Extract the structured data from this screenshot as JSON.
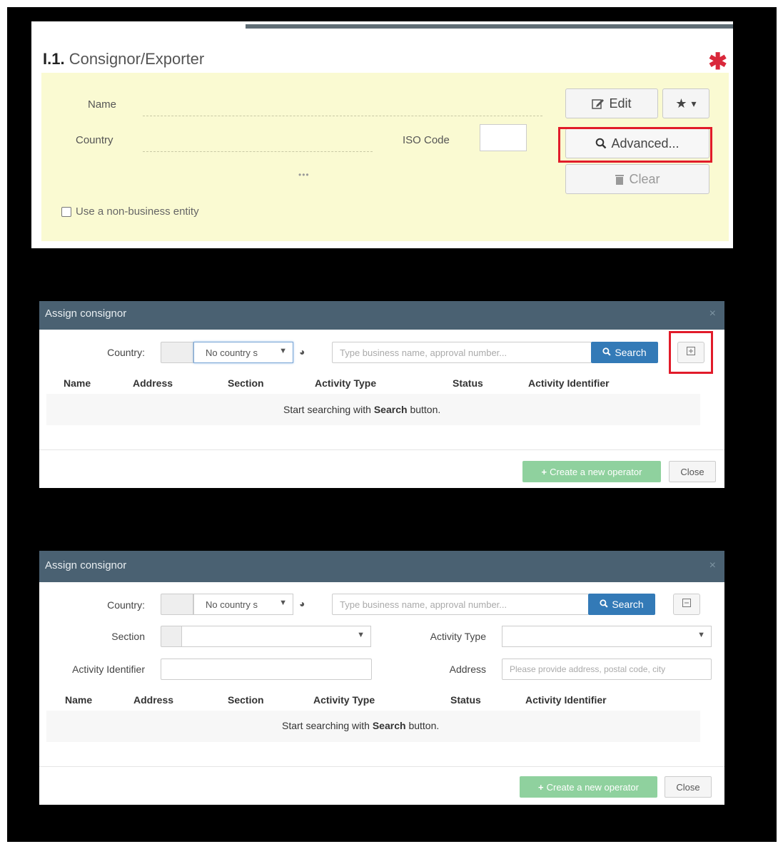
{
  "consignor_panel": {
    "section_number": "I.1.",
    "section_title": "Consignor/Exporter",
    "required_marker": "✱",
    "fields": {
      "name_label": "Name",
      "country_label": "Country",
      "iso_label": "ISO Code",
      "ellipsis": "•••"
    },
    "buttons": {
      "edit": "Edit",
      "favorites_caret": "▾",
      "advanced": "Advanced...",
      "clear": "Clear"
    },
    "non_business_checkbox": "Use a non-business entity",
    "highlight_color": "#e11b2a"
  },
  "modal_simple": {
    "title": "Assign consignor",
    "close_x": "×",
    "country_label": "Country:",
    "country_select": "No country s",
    "search_placeholder": "Type business name, approval number...",
    "search_button": "Search",
    "columns": [
      "Name",
      "Address",
      "Section",
      "Activity Type",
      "Status",
      "Activity Identifier"
    ],
    "empty_prefix": "Start searching with",
    "empty_bold": "Search",
    "empty_suffix": "button.",
    "create_button": "Create a new operator",
    "close_button": "Close"
  },
  "modal_advanced": {
    "title": "Assign consignor",
    "close_x": "×",
    "country_label": "Country:",
    "country_select": "No country s",
    "search_placeholder": "Type business name, approval number...",
    "search_button": "Search",
    "section_label": "Section",
    "activity_type_label": "Activity Type",
    "activity_identifier_label": "Activity Identifier",
    "address_label": "Address",
    "address_placeholder": "Please provide address, postal code, city",
    "columns": [
      "Name",
      "Address",
      "Section",
      "Activity Type",
      "Status",
      "Activity Identifier"
    ],
    "empty_prefix": "Start searching with",
    "empty_bold": "Search",
    "empty_suffix": "button.",
    "create_button": "Create a new operator",
    "close_button": "Close"
  },
  "colors": {
    "modal_header": "#4a6172",
    "search_button": "#337ab7",
    "create_button": "#8fd19e",
    "panel_background": "#fafad2"
  }
}
